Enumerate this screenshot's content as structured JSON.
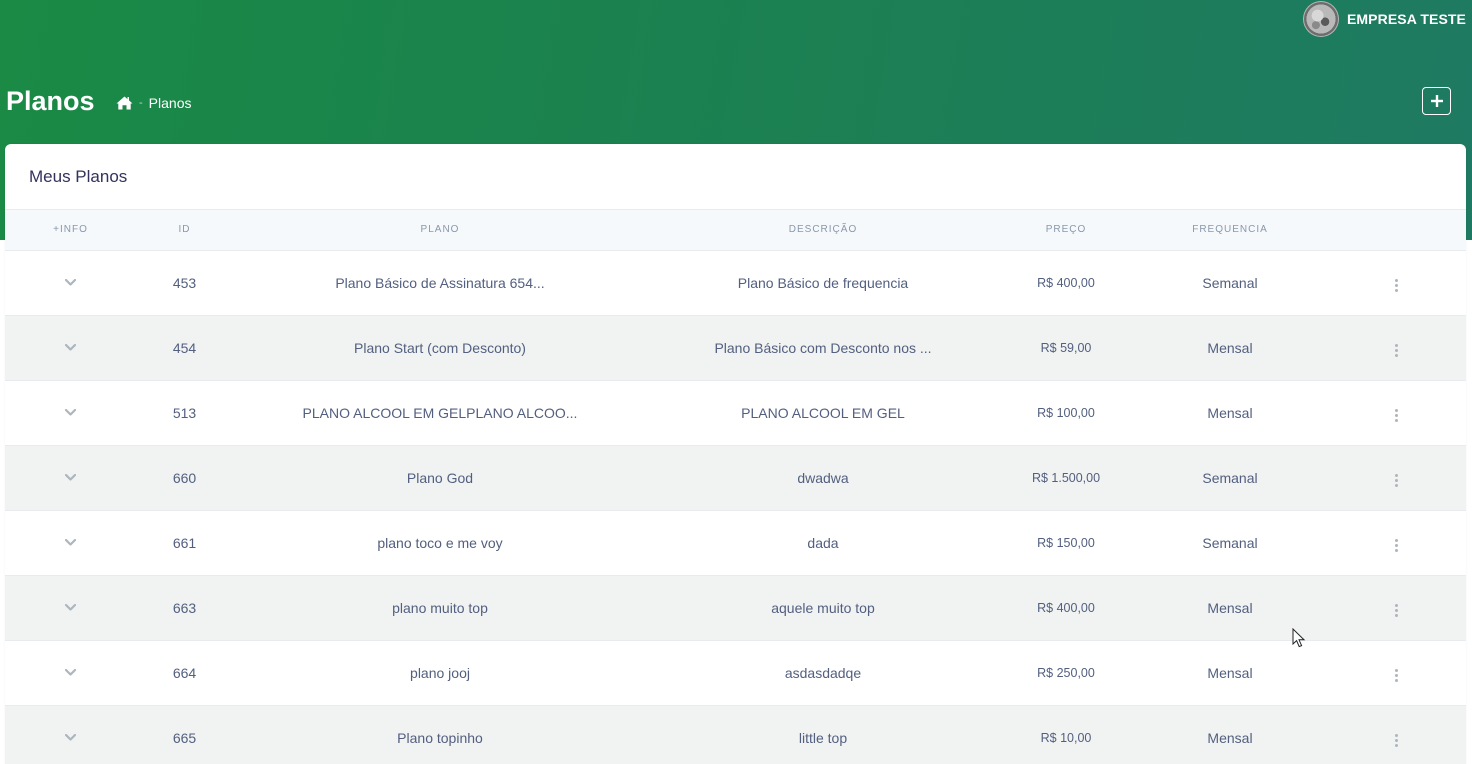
{
  "header": {
    "user_name": "EMPRESA TESTE",
    "page_title": "Planos",
    "breadcrumb_current": "Planos",
    "breadcrumb_separator": "-",
    "add_button_label": "+"
  },
  "card": {
    "title": "Meus Planos"
  },
  "table": {
    "columns": [
      "+Info",
      "ID",
      "Plano",
      "Descrição",
      "Preço",
      "Frequencia"
    ],
    "rows": [
      {
        "id": "453",
        "plano": "Plano Básico de Assinatura 654...",
        "descricao": "Plano Básico de frequencia",
        "preco": "R$ 400,00",
        "frequencia": "Semanal"
      },
      {
        "id": "454",
        "plano": "Plano Start (com Desconto)",
        "descricao": "Plano Básico com Desconto nos ...",
        "preco": "R$ 59,00",
        "frequencia": "Mensal"
      },
      {
        "id": "513",
        "plano": "PLANO ALCOOL EM GELPLANO ALCOO...",
        "descricao": "PLANO ALCOOL EM GEL",
        "preco": "R$ 100,00",
        "frequencia": "Mensal"
      },
      {
        "id": "660",
        "plano": "Plano God",
        "descricao": "dwadwa",
        "preco": "R$ 1.500,00",
        "frequencia": "Semanal"
      },
      {
        "id": "661",
        "plano": "plano toco e me voy",
        "descricao": "dada",
        "preco": "R$ 150,00",
        "frequencia": "Semanal"
      },
      {
        "id": "663",
        "plano": "plano muito top",
        "descricao": "aquele muito top",
        "preco": "R$ 400,00",
        "frequencia": "Mensal"
      },
      {
        "id": "664",
        "plano": "plano jooj",
        "descricao": "asdasdadqe",
        "preco": "R$ 250,00",
        "frequencia": "Mensal"
      },
      {
        "id": "665",
        "plano": "Plano topinho",
        "descricao": "little top",
        "preco": "R$ 10,00",
        "frequencia": "Mensal"
      }
    ]
  },
  "icons": {
    "home": "home-icon",
    "add": "plus-icon",
    "expand": "chevron-down-icon",
    "actions": "kebab-menu-icon"
  },
  "colors": {
    "header_gradient_start": "#1a8a45",
    "header_gradient_end": "#1e7a62",
    "row_alt": "#f1f2f2",
    "text": "#525f7f"
  }
}
